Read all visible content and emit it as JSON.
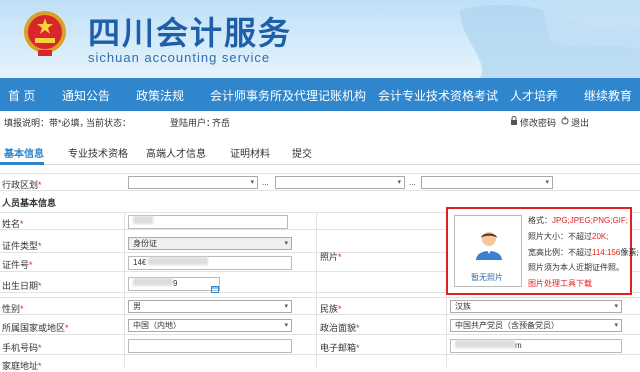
{
  "header": {
    "title": "四川会计服务",
    "subtitle": "sichuan accounting service"
  },
  "nav": {
    "items": [
      "首 页",
      "通知公告",
      "政策法规",
      "会计师事务所及代理记账机构",
      "会计专业技术资格考试",
      "人才培养",
      "继续教育"
    ]
  },
  "infobar": {
    "fill_note": "填报说明：带*必填，",
    "status": "当前状态：",
    "user_label": "登陆用户：",
    "user_name": "齐岳",
    "change_password": "修改密码",
    "logout": "退出"
  },
  "tabs": [
    "基本信息",
    "专业技术资格",
    "高端人才信息",
    "证明材料",
    "提交"
  ],
  "form": {
    "region_label": "行政区划",
    "separator": "...",
    "section_title": "人员基本信息",
    "name_label": "姓名",
    "name_value": "",
    "id_type_label": "证件类型",
    "id_type_value": "身份证",
    "id_no_label": "证件号",
    "id_no_value": "14€",
    "birth_label": "出生日期",
    "birth_value": "",
    "birth_suffix": "9",
    "photo_label": "照片",
    "gender_label": "性别",
    "gender_value": "男",
    "ethnic_label": "民族",
    "ethnic_value": "汉族",
    "country_label": "所属国家或地区",
    "country_value": "中国（内地）",
    "political_label": "政治面貌",
    "political_value": "中国共产党员（含预备党员）",
    "phone_label": "手机号码",
    "email_label": "电子邮箱",
    "email_suffix": "m",
    "address_label": "家庭地址"
  },
  "photo": {
    "placeholder": "暂无照片",
    "format_label": "格式：",
    "format_value": "JPG;JPEG;PNG;GIF;",
    "size_label": "照片大小：不超过",
    "size_value": "20K;",
    "ratio_label": "宽高比例：不超过",
    "ratio_value": "114:156",
    "ratio_suffix": "像素;",
    "requirement": "照片须为本人近期证件照。",
    "tool_link": "图片处理工具下载"
  },
  "colors": {
    "nav_bg": "#2f86cd",
    "brand": "#1f5ea8",
    "highlight": "#e02020"
  }
}
